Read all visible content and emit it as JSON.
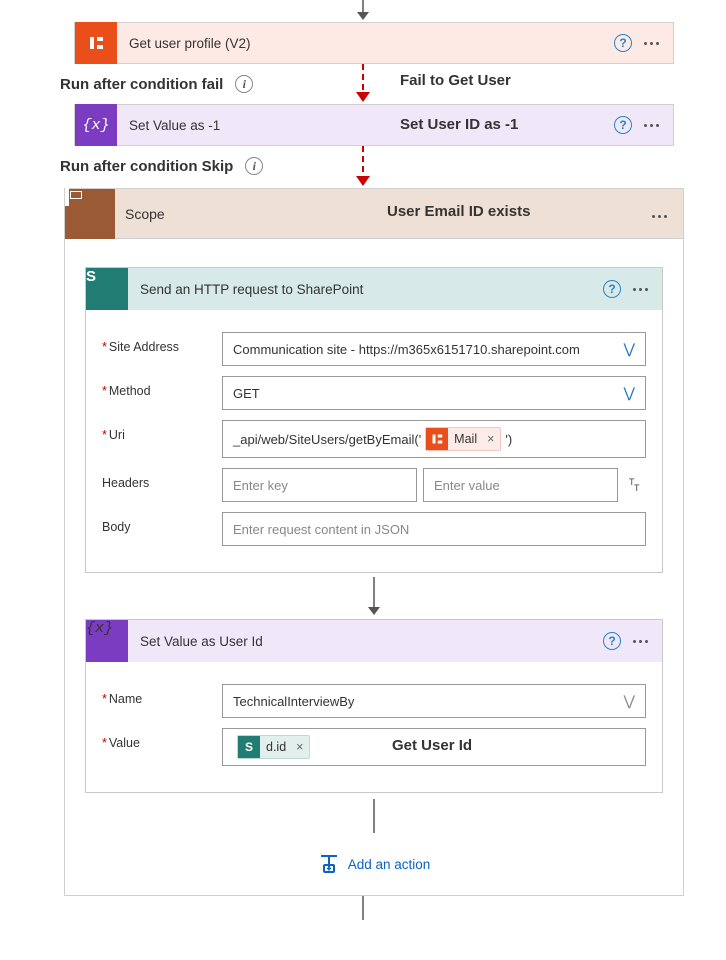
{
  "top_arrow": true,
  "action_get_user": {
    "title": "Get user profile (V2)"
  },
  "runafter_fail_label": "Run after condition fail",
  "annot_fail": "Fail to Get User",
  "action_set_minus1": {
    "title": "Set Value as -1"
  },
  "annot_set_minus1": "Set User ID as -1",
  "runafter_skip_label": "Run after condition Skip",
  "scope": {
    "title": "Scope",
    "annotation": "User Email ID exists",
    "http": {
      "title": "Send an HTTP request to SharePoint",
      "fields": {
        "site_label": "Site Address",
        "site_value": "Communication site - https://m365x6151710.sharepoint.com",
        "method_label": "Method",
        "method_value": "GET",
        "uri_label": "Uri",
        "uri_prefix": "_api/web/SiteUsers/getByEmail('",
        "uri_suffix": "')",
        "uri_token": "Mail",
        "headers_label": "Headers",
        "headers_key_ph": "Enter key",
        "headers_val_ph": "Enter value",
        "body_label": "Body",
        "body_ph": "Enter request content in JSON"
      }
    },
    "setvar": {
      "title": "Set Value as User Id",
      "annotation": "Get User Id",
      "name_label": "Name",
      "name_value": "TechnicalInterviewBy",
      "value_label": "Value",
      "value_token": "d.id"
    },
    "add_action_label": "Add an action"
  }
}
